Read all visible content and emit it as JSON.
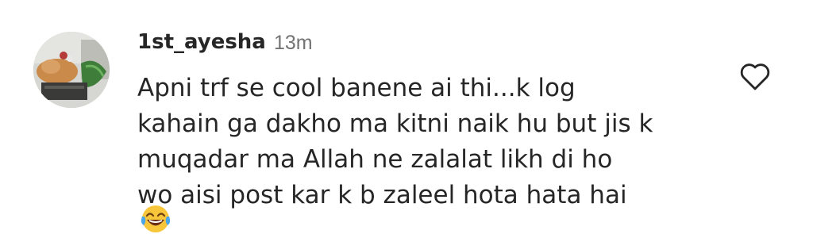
{
  "comment": {
    "username": "1st_ayesha",
    "timestamp": "13m",
    "text_lines": [
      "Apni trf se cool banene ai thi...k log",
      "kahain ga dakho ma kitni naik hu but jis k",
      "muqadar ma Allah ne zalalat likh di ho",
      "wo aisi post kar k b zaleel hota hata hai"
    ],
    "emoji": "face-with-tears-of-joy",
    "like_icon": "heart-outline-icon",
    "avatar_icon": "profile-photo"
  },
  "colors": {
    "text": "#262626",
    "muted": "#737373",
    "background": "#ffffff"
  }
}
